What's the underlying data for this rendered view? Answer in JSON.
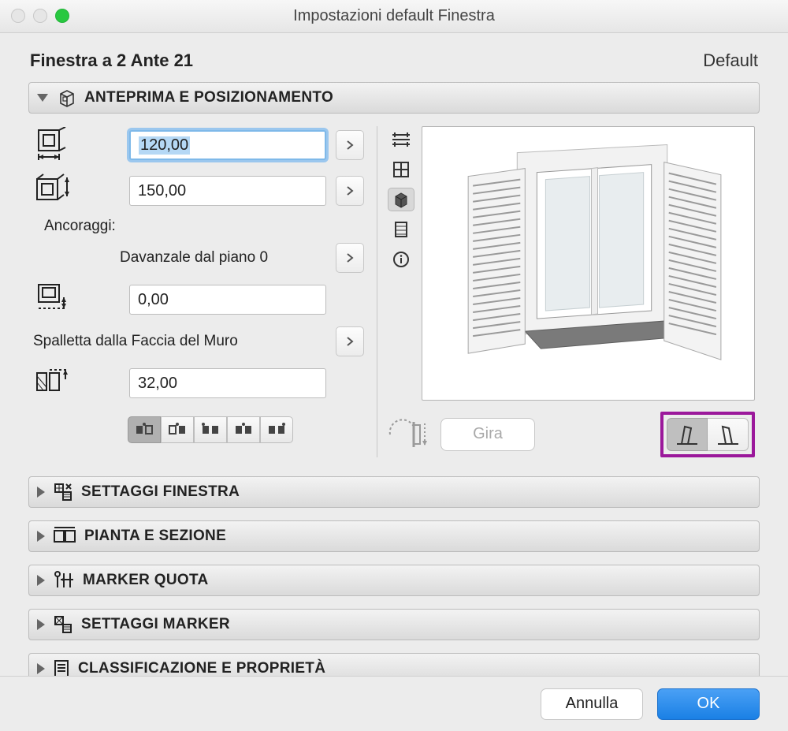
{
  "window": {
    "title": "Impostazioni default Finestra"
  },
  "header": {
    "object_name": "Finestra a 2 Ante 21",
    "preset": "Default"
  },
  "panel_preview": {
    "title": "ANTEPRIMA E POSIZIONAMENTO",
    "width_value": "120,00",
    "height_value": "150,00",
    "anchors_label": "Ancoraggi:",
    "anchor_mode": "Davanzale dal piano 0",
    "anchor_value": "0,00",
    "reveal_label": "Spalletta dalla Faccia del Muro",
    "reveal_value": "32,00",
    "flip_label": "Gira"
  },
  "sections": [
    {
      "title": "SETTAGGI FINESTRA"
    },
    {
      "title": "PIANTA E SEZIONE"
    },
    {
      "title": "MARKER QUOTA"
    },
    {
      "title": "SETTAGGI MARKER"
    },
    {
      "title": "CLASSIFICAZIONE E PROPRIETÀ"
    }
  ],
  "footer": {
    "cancel": "Annulla",
    "ok": "OK"
  }
}
